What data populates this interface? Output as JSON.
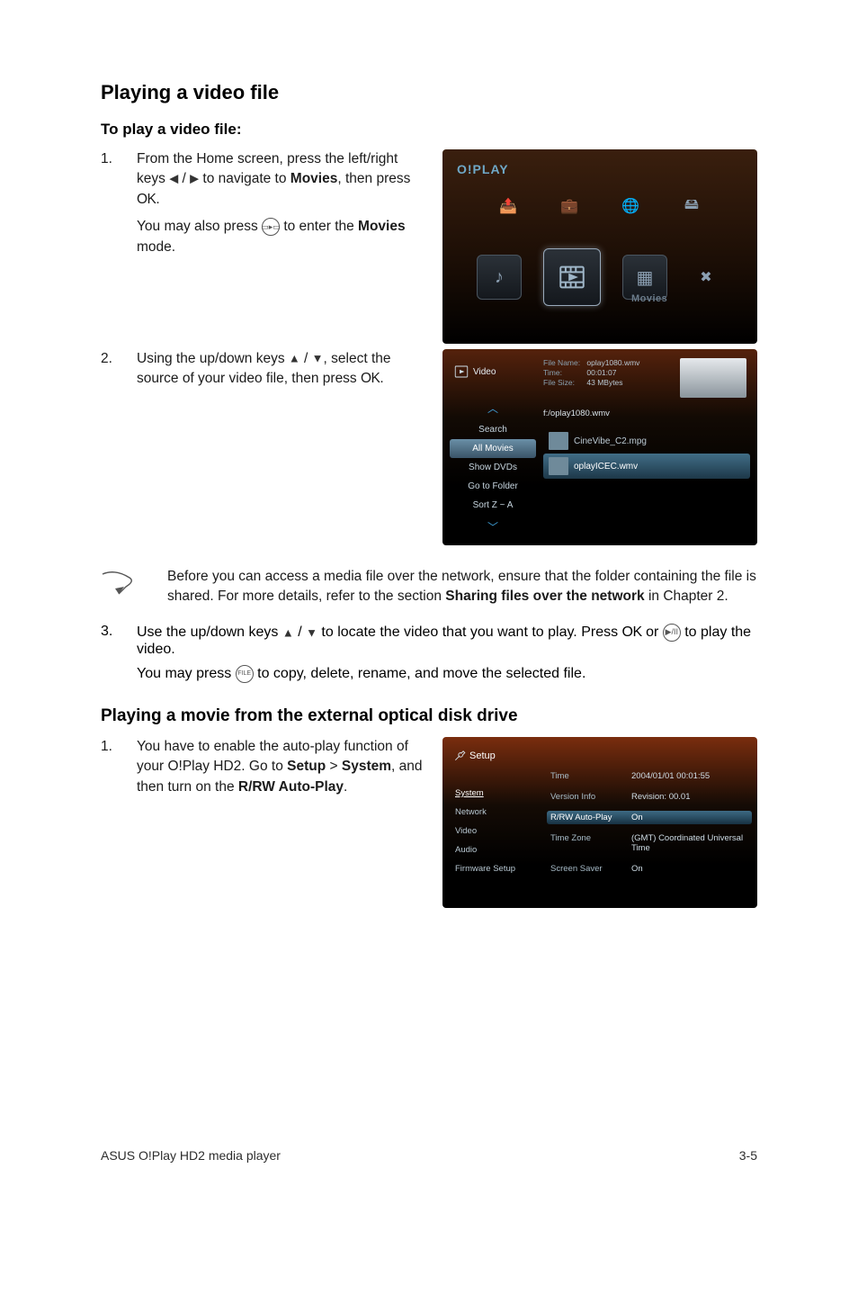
{
  "headings": {
    "main": "Playing a video file",
    "sub1": "To play a video file:",
    "sub2": "Playing a movie from the external optical disk drive"
  },
  "step1": {
    "num": "1.",
    "line1a": "From the Home screen, press the left/right keys ",
    "line1b": " to navigate to ",
    "movies": "Movies",
    "line1c": ", then press ",
    "ok": ".",
    "line2a": "You may also press ",
    "line2b": " to enter the ",
    "movies2": "Movies",
    "line2c": " mode."
  },
  "step2": {
    "num": "2.",
    "line1a": "Using the up/down keys ",
    "line1b": ", select the source of your video file, then press ",
    "ok": "."
  },
  "note": {
    "line1": "Before you can access a media file over the network, ensure that the folder containing the file is shared. For more details, refer to the section ",
    "bold": "Sharing files over the network",
    "line2": " in Chapter 2."
  },
  "step3": {
    "num": "3.",
    "line1a": "Use the up/down keys ",
    "line1b": " to locate the video that you want to play. Press ",
    "line1c": " or ",
    "line1d": " to play the video.",
    "line2a": "You may press ",
    "line2b": " to copy, delete, rename, and move the selected file."
  },
  "step4": {
    "num": "1.",
    "line1a": "You have to enable the auto-play function of your O!Play HD2. Go to ",
    "setup": "Setup",
    "gt": " > ",
    "system": "System",
    "line1b": ", and then turn on the ",
    "rrw": "R/RW Auto-Play",
    "line1c": "."
  },
  "ok_text": "",
  "screenshot1": {
    "logo": "O!PLAY",
    "label": "Movies"
  },
  "screenshot2": {
    "category": "Video",
    "meta": {
      "filename_lbl": "File Name:",
      "filename": "oplay1080.wmv",
      "time_lbl": "Time:",
      "time": "00:01:07",
      "size_lbl": "File Size:",
      "size": "43 MBytes"
    },
    "path": "f:/oplay1080.wmv",
    "menu": {
      "up_arrow": "︿",
      "search": "Search",
      "allmovies": "All Movies",
      "showdvds": "Show DVDs",
      "gotofolder": "Go to Folder",
      "sortza": "Sort Z ~ A",
      "down_arrow": "﹀"
    },
    "files": {
      "f1": "CineVibe_C2.mpg",
      "f2": "oplayICEC.wmv"
    }
  },
  "screenshot3": {
    "title": "Setup",
    "menu": {
      "system": "System",
      "network": "Network",
      "video": "Video",
      "audio": "Audio",
      "firmware": "Firmware Setup"
    },
    "rows": {
      "time_k": "Time",
      "time_v": "2004/01/01 00:01:55",
      "ver_k": "Version Info",
      "ver_v": "Revision: 00.01",
      "auto_k": "R/RW Auto-Play",
      "auto_v": "On",
      "tz_k": "Time Zone",
      "tz_v": "(GMT) Coordinated Universal Time",
      "ss_k": "Screen Saver",
      "ss_v": "On"
    }
  },
  "footer": {
    "left": "ASUS O!Play HD2 media player",
    "right": "3-5"
  }
}
